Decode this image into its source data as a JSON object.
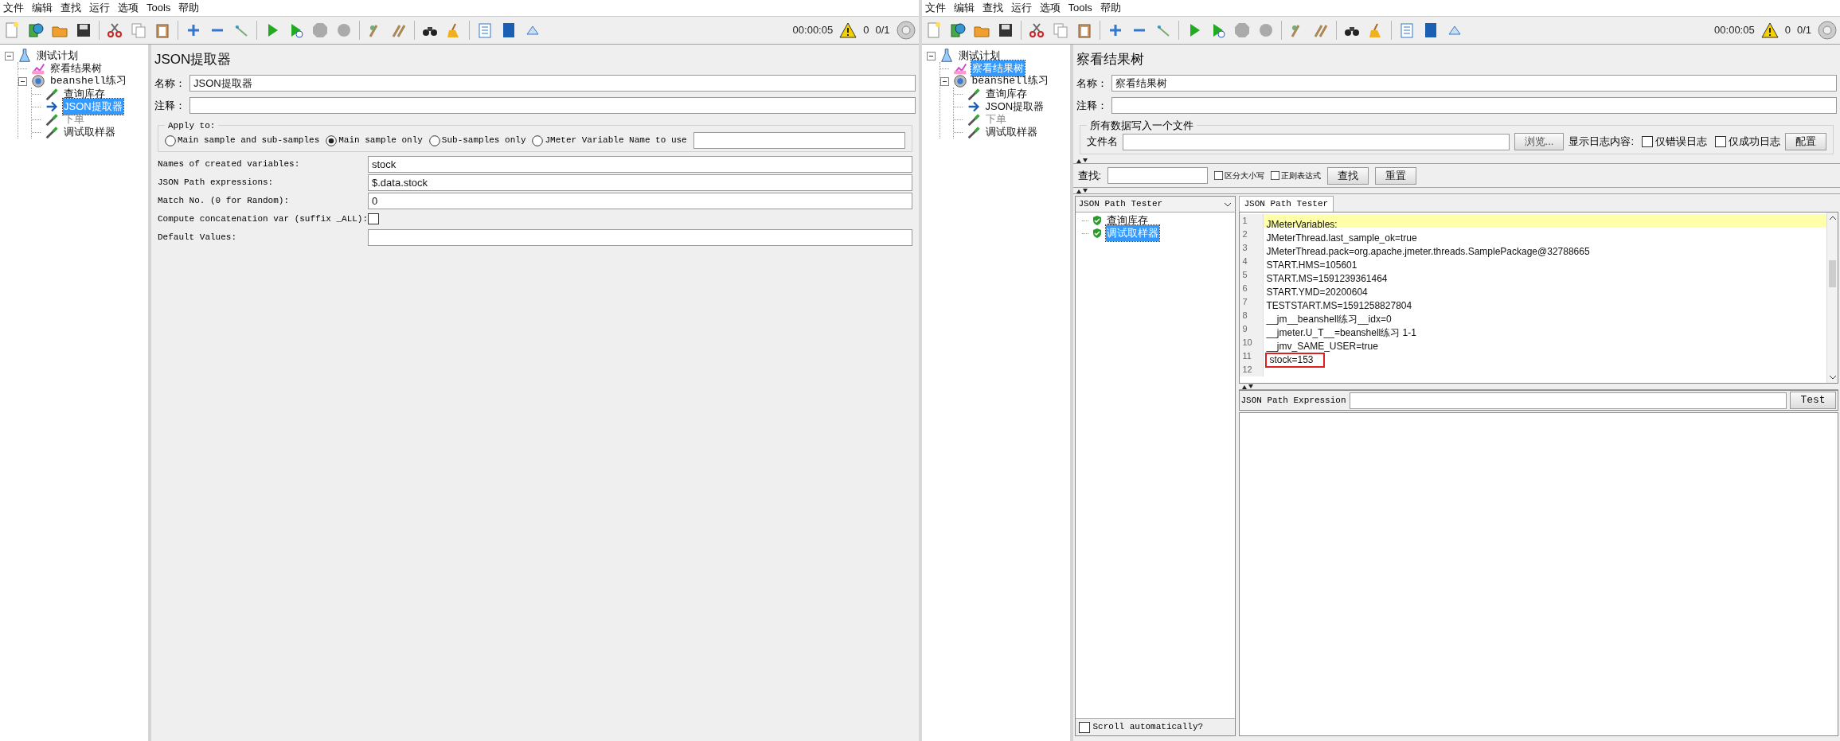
{
  "windows": [
    {
      "menu": [
        "文件",
        "编辑",
        "查找",
        "运行",
        "选项",
        "Tools",
        "帮助"
      ],
      "status": {
        "timer": "00:00:05",
        "warnings": "0",
        "threads": "0/1"
      },
      "tree": [
        {
          "label": "测试计划",
          "kind": "plan",
          "selected": false,
          "disabled": false,
          "expanded": true,
          "children": [
            {
              "label": "察看结果树",
              "kind": "listener",
              "selected": false,
              "disabled": false
            },
            {
              "label": "beanshell练习",
              "kind": "thread_group",
              "selected": false,
              "disabled": false,
              "expanded": true,
              "children": [
                {
                  "label": "查询库存",
                  "kind": "sampler",
                  "selected": false,
                  "disabled": false
                },
                {
                  "label": "JSON提取器",
                  "kind": "extractor",
                  "selected": true,
                  "disabled": false
                },
                {
                  "label": "下单",
                  "kind": "sampler",
                  "selected": false,
                  "disabled": true
                },
                {
                  "label": "调试取样器",
                  "kind": "sampler",
                  "selected": false,
                  "disabled": false
                }
              ]
            }
          ]
        }
      ],
      "panel": {
        "kind": "json_extractor",
        "title": "JSON提取器",
        "name_label": "名称：",
        "name_value": "JSON提取器",
        "comment_label": "注释：",
        "apply_to": {
          "legend": "Apply to:",
          "options": [
            {
              "label": "Main sample and sub-samples",
              "selected": false
            },
            {
              "label": "Main sample only",
              "selected": true
            },
            {
              "label": "Sub-samples only",
              "selected": false
            },
            {
              "label": "JMeter Variable Name to use",
              "selected": false
            }
          ]
        },
        "fields": [
          {
            "kind": "text",
            "label": "Names of created variables:",
            "value": "stock"
          },
          {
            "kind": "text",
            "label": "JSON Path expressions:",
            "value": "$.data.stock"
          },
          {
            "kind": "text",
            "label": "Match No. (0 for Random):",
            "value": "0"
          },
          {
            "kind": "checkbox",
            "label": "Compute concatenation var (suffix _ALL):",
            "checked": false
          },
          {
            "kind": "text",
            "label": "Default Values:"
          }
        ]
      }
    },
    {
      "menu": [
        "文件",
        "编辑",
        "查找",
        "运行",
        "选项",
        "Tools",
        "帮助"
      ],
      "status": {
        "timer": "00:00:05",
        "warnings": "0",
        "threads": "0/1"
      },
      "tree": [
        {
          "label": "测试计划",
          "kind": "plan",
          "selected": false,
          "disabled": false,
          "expanded": true,
          "children": [
            {
              "label": "察看结果树",
              "kind": "listener",
              "selected": true,
              "disabled": false
            },
            {
              "label": "beanshell练习",
              "kind": "thread_group",
              "selected": false,
              "disabled": false,
              "expanded": true,
              "children": [
                {
                  "label": "查询库存",
                  "kind": "sampler",
                  "selected": false,
                  "disabled": false
                },
                {
                  "label": "JSON提取器",
                  "kind": "extractor",
                  "selected": false,
                  "disabled": false
                },
                {
                  "label": "下单",
                  "kind": "sampler",
                  "selected": false,
                  "disabled": true
                },
                {
                  "label": "调试取样器",
                  "kind": "sampler",
                  "selected": false,
                  "disabled": false
                }
              ]
            }
          ]
        }
      ],
      "panel": {
        "kind": "results_tree",
        "title": "察看结果树",
        "name_label": "名称：",
        "name_value": "察看结果树",
        "comment_label": "注释：",
        "file_section": {
          "legend": "所有数据写入一个文件",
          "file_label": "文件名",
          "browse_button": "浏览...",
          "log_label": "显示日志内容:",
          "log_options": [
            {
              "label": "仅错误日志",
              "checked": false
            },
            {
              "label": "仅成功日志",
              "checked": false
            }
          ],
          "config_button": "配置"
        },
        "search": {
          "label": "查找:",
          "options": [
            {
              "label": "区分大小写",
              "checked": false
            },
            {
              "label": "正则表达式",
              "checked": false
            }
          ],
          "buttons": [
            "查找",
            "重置"
          ]
        },
        "renderer": "JSON Path Tester",
        "samples": [
          {
            "label": "查询库存",
            "passed": true,
            "selected": false
          },
          {
            "label": "调试取样器",
            "passed": true,
            "selected": true
          }
        ],
        "scroll_auto": {
          "label": "Scroll automatically?",
          "checked": false
        },
        "tab": "JSON Path Tester",
        "lines": [
          {
            "number": "1",
            "text": "JMeterVariables:",
            "highlighted": true,
            "boxed": false
          },
          {
            "number": "2",
            "text": "JMeterThread.last_sample_ok=true",
            "highlighted": false,
            "boxed": false
          },
          {
            "number": "3",
            "text": "JMeterThread.pack=org.apache.jmeter.threads.SamplePackage@32788665",
            "highlighted": false,
            "boxed": false
          },
          {
            "number": "4",
            "text": "START.HMS=105601",
            "highlighted": false,
            "boxed": false
          },
          {
            "number": "5",
            "text": "START.MS=1591239361464",
            "highlighted": false,
            "boxed": false
          },
          {
            "number": "6",
            "text": "START.YMD=20200604",
            "highlighted": false,
            "boxed": false
          },
          {
            "number": "7",
            "text": "TESTSTART.MS=1591258827804",
            "highlighted": false,
            "boxed": false
          },
          {
            "number": "8",
            "text": "__jm__beanshell练习__idx=0",
            "highlighted": false,
            "boxed": false
          },
          {
            "number": "9",
            "text": "__jmeter.U_T__=beanshell练习 1-1",
            "highlighted": false,
            "boxed": false
          },
          {
            "number": "10",
            "text": "__jmv_SAME_USER=true",
            "highlighted": false,
            "boxed": false
          },
          {
            "number": "11",
            "text": "stock=153",
            "highlighted": false,
            "boxed": true
          },
          {
            "number": "12",
            "highlighted": false,
            "boxed": false
          }
        ],
        "expression_label": "JSON Path Expression",
        "test_button": "Test"
      }
    }
  ]
}
